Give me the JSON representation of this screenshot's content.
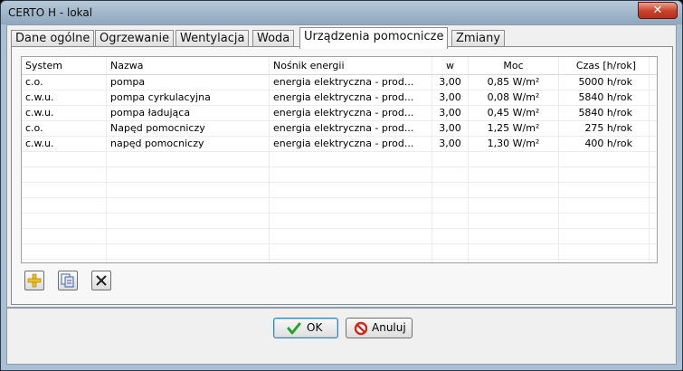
{
  "window": {
    "title": "CERTO H - lokal",
    "close_glyph": "✕"
  },
  "tabs": [
    {
      "label": "Dane ogólne"
    },
    {
      "label": "Ogrzewanie"
    },
    {
      "label": "Wentylacja"
    },
    {
      "label": "Woda"
    },
    {
      "label": "Urządzenia pomocnicze",
      "active": true
    },
    {
      "label": "Zmiany"
    }
  ],
  "table": {
    "headers": [
      "System",
      "Nazwa",
      "Nośnik energii",
      "w",
      "Moc",
      "Czas [h/rok]"
    ],
    "rows": [
      [
        "c.o.",
        "pompa",
        "energia elektryczna - prod...",
        "3,00",
        "0,85 W/m²",
        "5000 h/rok"
      ],
      [
        "c.w.u.",
        "pompa cyrkulacyjna",
        "energia elektryczna - prod...",
        "3,00",
        "0,08 W/m²",
        "5840 h/rok"
      ],
      [
        "c.w.u.",
        "pompa ładująca",
        "energia elektryczna - prod...",
        "3,00",
        "0,45 W/m²",
        "5840 h/rok"
      ],
      [
        "c.o.",
        "Napęd pomocniczy",
        "energia elektryczna - prod...",
        "3,00",
        "1,25 W/m²",
        "275 h/rok"
      ],
      [
        "c.w.u.",
        "napęd pomocniczy",
        "energia elektryczna - prod...",
        "3,00",
        "1,30 W/m²",
        "400 h/rok"
      ]
    ],
    "empty_rows": 8
  },
  "toolbar": {
    "icons": [
      "add-icon",
      "copy-icon",
      "delete-icon"
    ]
  },
  "buttons": {
    "ok_label": "OK",
    "cancel_label": "Anuluj"
  },
  "colors": {
    "ok_check": "#2aa12a",
    "cancel_ring": "#d0281c",
    "add_plus": "#f0c020"
  }
}
